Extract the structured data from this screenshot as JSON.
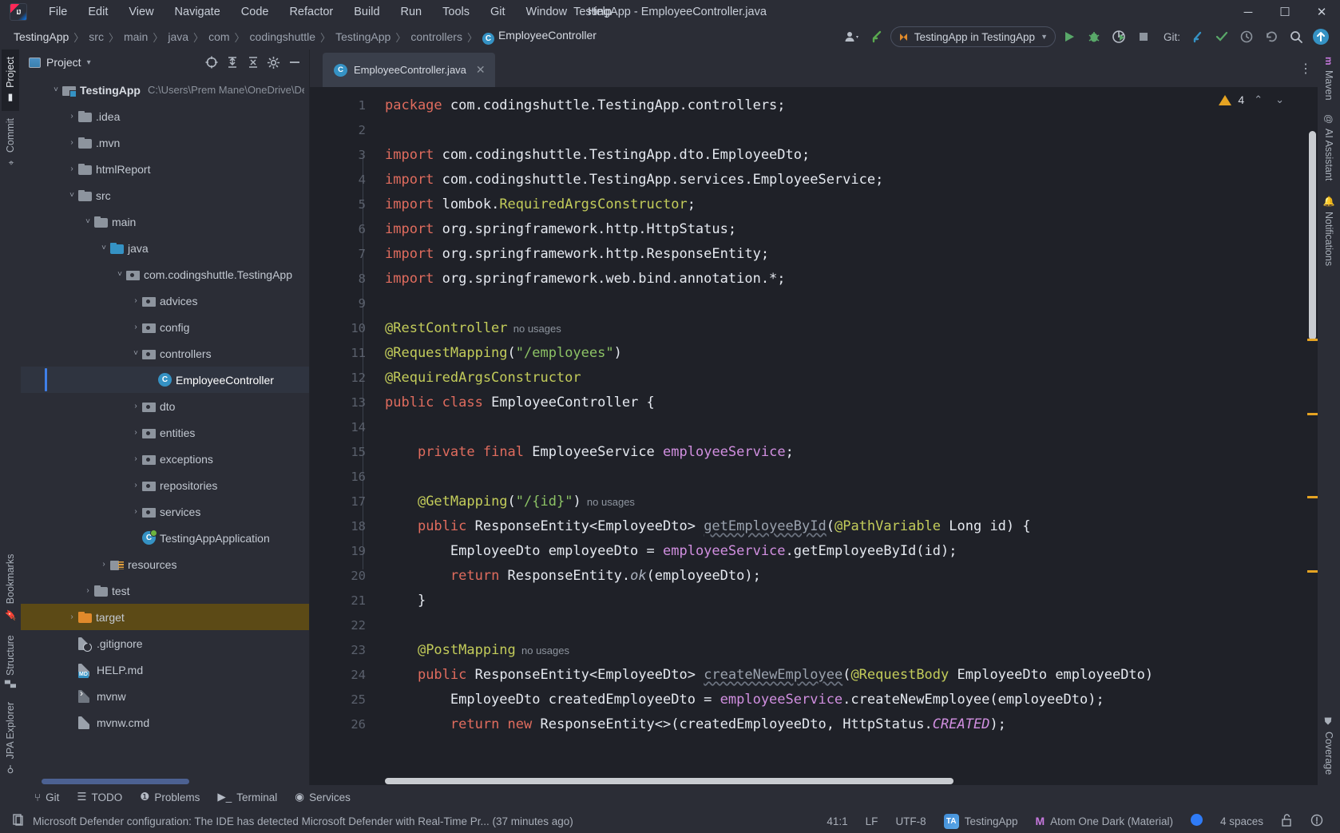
{
  "window": {
    "title": "TestingApp - EmployeeController.java",
    "logo_text": "IJ",
    "minimize": "─",
    "maximize": "☐",
    "close": "✕"
  },
  "menu": {
    "items": [
      {
        "label": "File"
      },
      {
        "label": "Edit"
      },
      {
        "label": "View"
      },
      {
        "label": "Navigate"
      },
      {
        "label": "Code"
      },
      {
        "label": "Refactor"
      },
      {
        "label": "Build"
      },
      {
        "label": "Run"
      },
      {
        "label": "Tools"
      },
      {
        "label": "Git"
      },
      {
        "label": "Window"
      },
      {
        "label": "Help"
      }
    ]
  },
  "breadcrumb": {
    "separator": "〉",
    "items": [
      {
        "label": "TestingApp"
      },
      {
        "label": "src"
      },
      {
        "label": "main"
      },
      {
        "label": "java"
      },
      {
        "label": "com"
      },
      {
        "label": "codingshuttle"
      },
      {
        "label": "TestingApp"
      },
      {
        "label": "controllers"
      },
      {
        "label": "EmployeeController"
      }
    ],
    "class_badge": "C"
  },
  "toolbar": {
    "run_config": "TestingApp in TestingApp",
    "run_config_chevron": "▼",
    "git_label": "Git:",
    "buttons": {
      "account": "👤",
      "update_project": "↙",
      "run": "▶",
      "debug": "🐞",
      "run_coverage": "▶",
      "stop": "■",
      "git_update": "↙",
      "git_commit": "✓",
      "git_history": "⧖",
      "git_rollback": "↺",
      "search": "🔍",
      "updates": "↑"
    }
  },
  "left_toolwindows": {
    "top": [
      {
        "label": "Project",
        "icon": "project-icon",
        "active": true
      },
      {
        "label": "Commit",
        "icon": "commit-icon",
        "active": false
      }
    ],
    "bottom": [
      {
        "label": "Bookmarks",
        "icon": "bookmark-icon"
      },
      {
        "label": "Structure",
        "icon": "structure-icon"
      },
      {
        "label": "JPA Explorer",
        "icon": "jpa-icon"
      }
    ]
  },
  "right_toolwindows": [
    {
      "label": "Maven",
      "icon": "maven-icon"
    },
    {
      "label": "AI Assistant",
      "icon": "ai-icon"
    },
    {
      "label": "Notifications",
      "icon": "notifications-icon"
    },
    {
      "label": "Coverage",
      "icon": "coverage-icon"
    }
  ],
  "project_panel": {
    "title": "Project",
    "title_chevron": "▾",
    "actions": {
      "locate": "⊕",
      "expand_all": "⤓",
      "collapse_all": "⤒",
      "settings": "⚙",
      "hide": "─"
    },
    "tree": [
      {
        "indent": 0,
        "arrow": "˅",
        "icon": "module-icon",
        "label": "TestingApp",
        "path": "C:\\Users\\Prem Mane\\OneDrive\\De",
        "bold": true
      },
      {
        "indent": 1,
        "arrow": "›",
        "icon": "folder-icon",
        "label": ".idea"
      },
      {
        "indent": 1,
        "arrow": "›",
        "icon": "folder-icon",
        "label": ".mvn"
      },
      {
        "indent": 1,
        "arrow": "›",
        "icon": "folder-icon",
        "label": "htmlReport"
      },
      {
        "indent": 1,
        "arrow": "˅",
        "icon": "folder-icon",
        "label": "src"
      },
      {
        "indent": 2,
        "arrow": "˅",
        "icon": "folder-icon",
        "label": "main"
      },
      {
        "indent": 3,
        "arrow": "˅",
        "icon": "folder-blue-icon",
        "label": "java"
      },
      {
        "indent": 4,
        "arrow": "˅",
        "icon": "package-icon",
        "label": "com.codingshuttle.TestingApp"
      },
      {
        "indent": 5,
        "arrow": "›",
        "icon": "package-icon",
        "label": "advices"
      },
      {
        "indent": 5,
        "arrow": "›",
        "icon": "package-icon",
        "label": "config"
      },
      {
        "indent": 5,
        "arrow": "˅",
        "icon": "package-icon",
        "label": "controllers"
      },
      {
        "indent": 6,
        "arrow": "",
        "icon": "class-icon",
        "label": "EmployeeController",
        "selected": true
      },
      {
        "indent": 5,
        "arrow": "›",
        "icon": "package-icon",
        "label": "dto"
      },
      {
        "indent": 5,
        "arrow": "›",
        "icon": "package-icon",
        "label": "entities"
      },
      {
        "indent": 5,
        "arrow": "›",
        "icon": "package-icon",
        "label": "exceptions"
      },
      {
        "indent": 5,
        "arrow": "›",
        "icon": "package-icon",
        "label": "repositories"
      },
      {
        "indent": 5,
        "arrow": "›",
        "icon": "package-icon",
        "label": "services"
      },
      {
        "indent": 5,
        "arrow": "",
        "icon": "spring-class-icon",
        "label": "TestingAppApplication"
      },
      {
        "indent": 3,
        "arrow": "›",
        "icon": "resources-icon",
        "label": "resources"
      },
      {
        "indent": 2,
        "arrow": "›",
        "icon": "folder-icon",
        "label": "test"
      },
      {
        "indent": 1,
        "arrow": "›",
        "icon": "folder-orange-icon",
        "label": "target",
        "highlight": true
      },
      {
        "indent": 1,
        "arrow": "",
        "icon": "gitignore-file-icon",
        "label": ".gitignore"
      },
      {
        "indent": 1,
        "arrow": "",
        "icon": "md-file-icon",
        "label": "HELP.md",
        "badge": "MD"
      },
      {
        "indent": 1,
        "arrow": "",
        "icon": "script-file-icon",
        "label": "mvnw"
      },
      {
        "indent": 1,
        "arrow": "",
        "icon": "file-icon",
        "label": "mvnw.cmd"
      }
    ]
  },
  "editor": {
    "tab": {
      "label": "EmployeeController.java",
      "badge": "C",
      "close": "✕"
    },
    "more_button": "⋮",
    "inspections": {
      "count": "4",
      "up": "⌃",
      "down": "⌄"
    },
    "lines": [
      {
        "n": "1",
        "fold": "",
        "tokens": [
          {
            "t": "package ",
            "c": "kw"
          },
          {
            "t": "com.codingshuttle.TestingApp.controllers;",
            "c": "cls"
          }
        ]
      },
      {
        "n": "2",
        "fold": "",
        "tokens": []
      },
      {
        "n": "3",
        "fold": "minus",
        "tokens": [
          {
            "t": "import ",
            "c": "kw"
          },
          {
            "t": "com.codingshuttle.TestingApp.dto.EmployeeDto;",
            "c": "cls"
          }
        ]
      },
      {
        "n": "4",
        "fold": "",
        "tokens": [
          {
            "t": "import ",
            "c": "kw"
          },
          {
            "t": "com.codingshuttle.TestingApp.services.EmployeeService;",
            "c": "cls"
          }
        ]
      },
      {
        "n": "5",
        "fold": "",
        "tokens": [
          {
            "t": "import ",
            "c": "kw"
          },
          {
            "t": "lombok.",
            "c": "cls"
          },
          {
            "t": "RequiredArgsConstructor",
            "c": "ann"
          },
          {
            "t": ";",
            "c": "cls"
          }
        ]
      },
      {
        "n": "6",
        "fold": "",
        "tokens": [
          {
            "t": "import ",
            "c": "kw"
          },
          {
            "t": "org.springframework.http.HttpStatus;",
            "c": "cls"
          }
        ]
      },
      {
        "n": "7",
        "fold": "",
        "tokens": [
          {
            "t": "import ",
            "c": "kw"
          },
          {
            "t": "org.springframework.http.ResponseEntity;",
            "c": "cls"
          }
        ]
      },
      {
        "n": "8",
        "fold": "end",
        "tokens": [
          {
            "t": "import ",
            "c": "kw"
          },
          {
            "t": "org.springframework.web.bind.annotation.*;",
            "c": "cls"
          }
        ]
      },
      {
        "n": "9",
        "fold": "",
        "tokens": []
      },
      {
        "n": "10",
        "fold": "minus",
        "tokens": [
          {
            "t": "@RestController",
            "c": "ann"
          },
          {
            "t": "  no usages",
            "c": "usages"
          }
        ]
      },
      {
        "n": "11",
        "fold": "",
        "tokens": [
          {
            "t": "@RequestMapping",
            "c": "ann"
          },
          {
            "t": "(",
            "c": "cls"
          },
          {
            "t": "\"/employees\"",
            "c": "str"
          },
          {
            "t": ")",
            "c": "cls"
          }
        ]
      },
      {
        "n": "12",
        "fold": "end",
        "tokens": [
          {
            "t": "@RequiredArgsConstructor",
            "c": "ann"
          }
        ]
      },
      {
        "n": "13",
        "fold": "",
        "tokens": [
          {
            "t": "public ",
            "c": "kw"
          },
          {
            "t": "class ",
            "c": "kw"
          },
          {
            "t": "EmployeeController {",
            "c": "cls"
          }
        ]
      },
      {
        "n": "14",
        "fold": "",
        "tokens": []
      },
      {
        "n": "15",
        "fold": "",
        "tokens": [
          {
            "t": "    ",
            "c": "cls"
          },
          {
            "t": "private ",
            "c": "kw"
          },
          {
            "t": "final ",
            "c": "kw"
          },
          {
            "t": "EmployeeService ",
            "c": "cls"
          },
          {
            "t": "employeeService",
            "c": "fld"
          },
          {
            "t": ";",
            "c": "cls"
          }
        ]
      },
      {
        "n": "16",
        "fold": "",
        "tokens": []
      },
      {
        "n": "17",
        "fold": "",
        "tokens": [
          {
            "t": "    ",
            "c": "cls"
          },
          {
            "t": "@GetMapping",
            "c": "ann"
          },
          {
            "t": "(",
            "c": "cls"
          },
          {
            "t": "\"/{id}\"",
            "c": "str"
          },
          {
            "t": ")",
            "c": "cls"
          },
          {
            "t": "  no usages",
            "c": "usages"
          }
        ]
      },
      {
        "n": "18",
        "fold": "minus",
        "tokens": [
          {
            "t": "    ",
            "c": "cls"
          },
          {
            "t": "public ",
            "c": "kw"
          },
          {
            "t": "ResponseEntity<EmployeeDto> ",
            "c": "cls"
          },
          {
            "t": "getEmployeeById",
            "c": "mth"
          },
          {
            "t": "(",
            "c": "cls"
          },
          {
            "t": "@PathVariable",
            "c": "ann"
          },
          {
            "t": " Long id) {",
            "c": "cls"
          }
        ]
      },
      {
        "n": "19",
        "fold": "",
        "tokens": [
          {
            "t": "        EmployeeDto employeeDto = ",
            "c": "cls"
          },
          {
            "t": "employeeService",
            "c": "fld"
          },
          {
            "t": ".getEmployeeById(id);",
            "c": "cls"
          }
        ]
      },
      {
        "n": "20",
        "fold": "",
        "tokens": [
          {
            "t": "        ",
            "c": "cls"
          },
          {
            "t": "return ",
            "c": "kw"
          },
          {
            "t": "ResponseEntity.",
            "c": "cls"
          },
          {
            "t": "ok",
            "c": "itl"
          },
          {
            "t": "(employeeDto);",
            "c": "cls"
          }
        ]
      },
      {
        "n": "21",
        "fold": "end",
        "tokens": [
          {
            "t": "    }",
            "c": "cls"
          }
        ]
      },
      {
        "n": "22",
        "fold": "",
        "tokens": []
      },
      {
        "n": "23",
        "fold": "",
        "tokens": [
          {
            "t": "    ",
            "c": "cls"
          },
          {
            "t": "@PostMapping",
            "c": "ann"
          },
          {
            "t": "  no usages",
            "c": "usages"
          }
        ]
      },
      {
        "n": "24",
        "fold": "minus",
        "tokens": [
          {
            "t": "    ",
            "c": "cls"
          },
          {
            "t": "public ",
            "c": "kw"
          },
          {
            "t": "ResponseEntity<EmployeeDto> ",
            "c": "cls"
          },
          {
            "t": "createNewEmployee",
            "c": "mth"
          },
          {
            "t": "(",
            "c": "cls"
          },
          {
            "t": "@RequestBody",
            "c": "ann"
          },
          {
            "t": " EmployeeDto employeeDto)",
            "c": "cls"
          }
        ]
      },
      {
        "n": "25",
        "fold": "",
        "tokens": [
          {
            "t": "        EmployeeDto createdEmployeeDto = ",
            "c": "cls"
          },
          {
            "t": "employeeService",
            "c": "fld"
          },
          {
            "t": ".createNewEmployee(employeeDto);",
            "c": "cls"
          }
        ]
      },
      {
        "n": "26",
        "fold": "",
        "tokens": [
          {
            "t": "        ",
            "c": "cls"
          },
          {
            "t": "return ",
            "c": "kw"
          },
          {
            "t": "new ",
            "c": "kw"
          },
          {
            "t": "ResponseEntity<>(createdEmployeeDto, HttpStatus.",
            "c": "cls"
          },
          {
            "t": "CREATED",
            "c": "cst"
          },
          {
            "t": ");",
            "c": "cls"
          }
        ]
      }
    ]
  },
  "bottom_tabs": [
    {
      "label": "Git",
      "icon": "git-branch-icon"
    },
    {
      "label": "TODO",
      "icon": "todo-icon"
    },
    {
      "label": "Problems",
      "icon": "problems-icon"
    },
    {
      "label": "Terminal",
      "icon": "terminal-icon"
    },
    {
      "label": "Services",
      "icon": "services-icon"
    }
  ],
  "statusbar": {
    "message": "Microsoft Defender configuration: The IDE has detected Microsoft Defender with Real-Time Pr... (37 minutes ago)",
    "caret": "41:1",
    "line_sep": "LF",
    "encoding": "UTF-8",
    "module_badge": "TA",
    "module": "TestingApp",
    "theme_badge": "M",
    "theme": "Atom One Dark (Material)",
    "indent": "4 spaces",
    "lock_icon": "🔓",
    "notify_icon": "❗"
  },
  "colors": {
    "chrome_bg": "#2b2d36",
    "editor_bg": "#1f2128",
    "accent_blue": "#3592c4",
    "warning": "#e5a322",
    "selection": "#2f3440",
    "target_highlight": "#5c4a16"
  }
}
